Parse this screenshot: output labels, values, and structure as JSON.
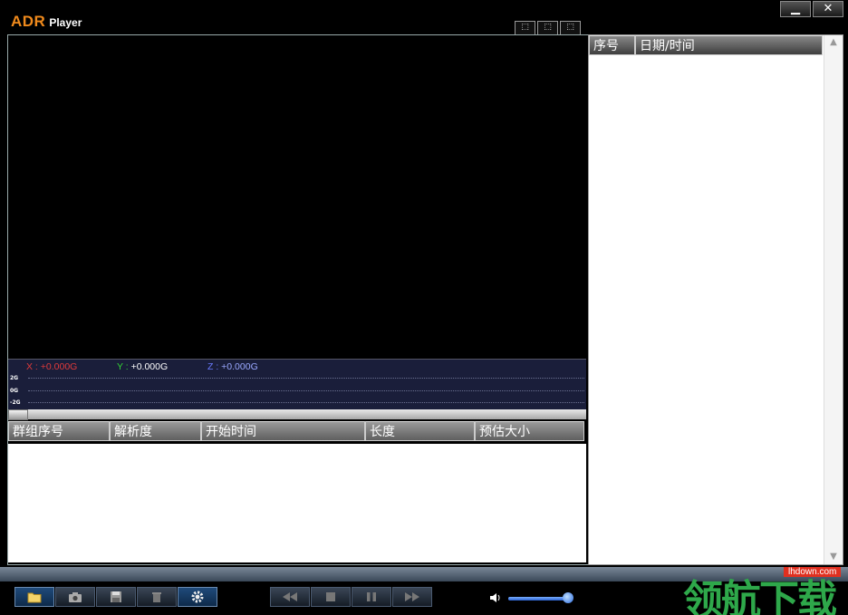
{
  "app": {
    "logo_brand": "ADR",
    "logo_product": "Player"
  },
  "window_controls": {
    "minimize": "▁",
    "close": "✕"
  },
  "view_buttons": [
    "⬚",
    "⬚",
    "⬚"
  ],
  "gsensor": {
    "x": {
      "prefix": "X : ",
      "value": "+0.000G",
      "prefix_color": "#e03a3a",
      "value_color": "#e03a3a"
    },
    "y": {
      "prefix": "Y : ",
      "value": "+0.000G",
      "prefix_color": "#33d633",
      "value_color": "#ffffff"
    },
    "z": {
      "prefix": "Z : ",
      "value": "+0.000G",
      "prefix_color": "#6a7aff",
      "value_color": "#9aa8ff"
    },
    "axis_labels": [
      "2G",
      "0G",
      "-2G"
    ]
  },
  "file_table": {
    "columns": [
      "群组序号",
      "解析度",
      "开始时间",
      "长度",
      "预估大小"
    ]
  },
  "event_list": {
    "columns": [
      "序号",
      "日期/时间"
    ]
  },
  "toolbar": {
    "icons": [
      "folder-icon",
      "camera-icon",
      "save-icon",
      "trash-icon",
      "gear-icon",
      "rewind-icon",
      "stop-icon",
      "pause-icon",
      "fast-forward-icon",
      "volume-icon",
      "waveform-icon"
    ],
    "volume_level": 1.0
  },
  "watermark": {
    "site": "lhdown.com",
    "text": "领航下载"
  }
}
